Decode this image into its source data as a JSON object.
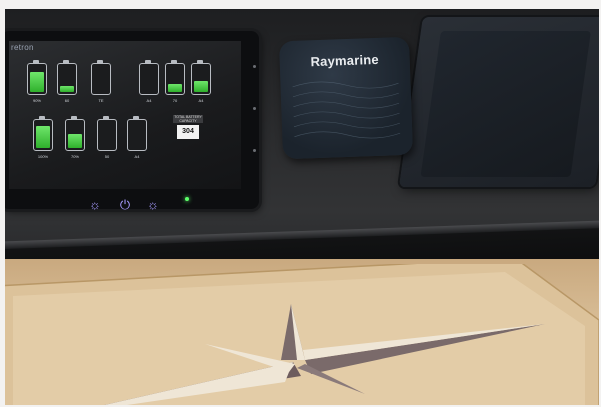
{
  "scene": {
    "description_visible_text": {
      "panel_brand": "retron",
      "plotter_brand": "Raymarine",
      "readout_caption": "TOTAL BATTERY CAPACITY",
      "readout_value": "304"
    }
  },
  "battery_monitor": {
    "batteries": [
      {
        "level": 0.85,
        "label": "90%"
      },
      {
        "level": 0.25,
        "label": "60"
      },
      {
        "level": 0.0,
        "label": "TE"
      },
      {
        "level": 0.0,
        "label": "A4"
      },
      {
        "level": 0.35,
        "label": "70"
      },
      {
        "level": 0.45,
        "label": "A4"
      },
      {
        "level": 0.9,
        "label": "100%"
      },
      {
        "level": 0.6,
        "label": "70%"
      },
      {
        "level": 0.0,
        "label": "50"
      },
      {
        "level": 0.0,
        "label": "A4"
      }
    ]
  },
  "hardware_buttons": [
    {
      "icon": "brightness-icon",
      "glyph": "☼"
    },
    {
      "icon": "power-icon",
      "glyph": "⏻"
    },
    {
      "icon": "settings-icon",
      "glyph": "☼"
    }
  ],
  "colors": {
    "battery_fill": "#3fd03b",
    "button_glyph": "#a89cff",
    "status_led": "#5cff6a"
  }
}
